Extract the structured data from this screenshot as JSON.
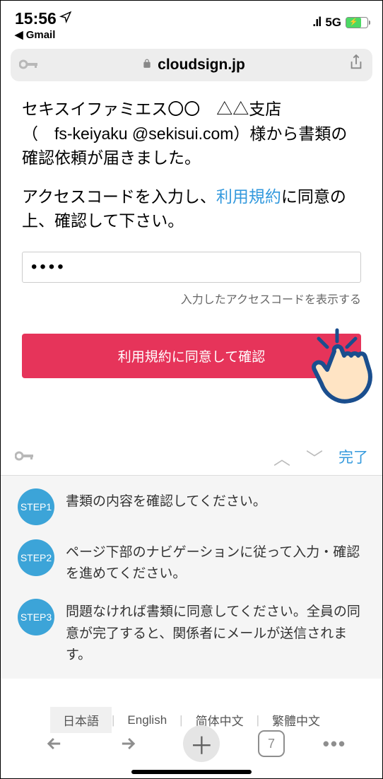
{
  "status": {
    "time": "15:56",
    "back_app": "Gmail",
    "network": "5G"
  },
  "browser": {
    "domain": "cloudsign.jp",
    "tab_count": "7"
  },
  "page": {
    "sender_line1": "セキスイファミエス〇〇　△△支店",
    "sender_line2a": "（　fs-keiyaku @sekisui.com）様から書類の確認依頼が届きました。",
    "instruction_pre": "アクセスコードを入力し、",
    "terms_link": "利用規約",
    "instruction_post": "に同意の上、確認して下さい。",
    "code_value": "••••",
    "show_code_label": "入力したアクセスコードを表示する",
    "confirm_label": "利用規約に同意して確認"
  },
  "keyboard": {
    "done": "完了"
  },
  "steps": [
    {
      "badge": "STEP1",
      "text": "書類の内容を確認してください。"
    },
    {
      "badge": "STEP2",
      "text": "ページ下部のナビゲーションに従って入力・確認を進めてください。"
    },
    {
      "badge": "STEP3",
      "text": "問題なければ書類に同意してください。全員の同意が完了すると、関係者にメールが送信されます。"
    }
  ],
  "languages": {
    "ja": "日本語",
    "en": "English",
    "zh_cn": "简体中文",
    "zh_tw": "繁體中文"
  }
}
